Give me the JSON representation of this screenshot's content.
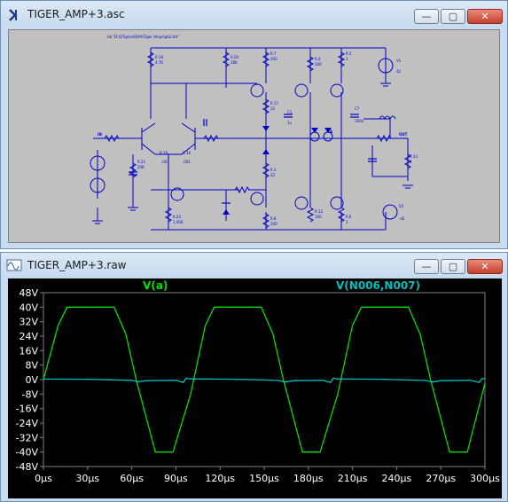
{
  "schematic_window": {
    "title": "TIGER_AMP+3.asc",
    "buttons": {
      "minimize": "—",
      "maximize": "▢",
      "close": "✕"
    },
    "directive": ".lib \"D:\\LTSpice\\DIYA\\Tiger Amps\\pb2.txt\"",
    "components": [
      {
        "ref": "R.18",
        "value": "4.7K"
      },
      {
        "ref": "R.20",
        "value": "18K"
      },
      {
        "ref": "R.7",
        "value": "200"
      },
      {
        "ref": "R.4",
        "value": "100"
      },
      {
        "ref": "R.5",
        "value": "1"
      },
      {
        "ref": "V1",
        "value": "42"
      },
      {
        "ref": "R.17",
        "value": "22"
      },
      {
        "ref": "C1",
        "value": "1u"
      },
      {
        "ref": "C7",
        "value": "100n"
      },
      {
        "ref": "R.19",
        "value": ".001"
      },
      {
        "ref": "R.16",
        "value": ".001"
      },
      {
        "ref": "R.21",
        "value": "20K"
      },
      {
        "ref": "R.3",
        "value": "22"
      },
      {
        "ref": "R.14",
        "value": "4"
      },
      {
        "ref": "R.22",
        "value": "1.95K"
      },
      {
        "ref": "R.12",
        "value": "100"
      },
      {
        "ref": "R.6",
        "value": "1"
      },
      {
        "ref": "R.8",
        "value": "200"
      },
      {
        "ref": "V2",
        "value": "-42"
      }
    ],
    "nets": {
      "input": "IN",
      "output": "OUT",
      "a": "A"
    }
  },
  "waveform_window": {
    "title": "TIGER_AMP+3.raw",
    "buttons": {
      "minimize": "—",
      "maximize": "▢",
      "close": "✕"
    }
  },
  "chart_data": {
    "type": "line",
    "xlabel": "",
    "ylabel": "",
    "xlim": [
      0,
      300
    ],
    "ylim": [
      -48,
      48
    ],
    "x_ticks": [
      "0µs",
      "30µs",
      "60µs",
      "90µs",
      "120µs",
      "150µs",
      "180µs",
      "210µs",
      "240µs",
      "270µs",
      "300µs"
    ],
    "y_ticks": [
      "48V",
      "40V",
      "32V",
      "24V",
      "16V",
      "8V",
      "0V",
      "-8V",
      "-16V",
      "-24V",
      "-32V",
      "-40V",
      "-48V"
    ],
    "grid": false,
    "series": [
      {
        "name": "V(a)",
        "color": "#00e000",
        "x": [
          0,
          10,
          16,
          28,
          48,
          56,
          63,
          76,
          84,
          88,
          100,
          110,
          116,
          128,
          148,
          156,
          163,
          176,
          184,
          188,
          200,
          210,
          216,
          228,
          248,
          256,
          263,
          276,
          284,
          288,
          300
        ],
        "y": [
          0,
          30,
          40,
          40,
          40,
          25,
          0,
          -40,
          -40,
          -40,
          -8,
          30,
          40,
          40,
          40,
          25,
          0,
          -40,
          -40,
          -40,
          -8,
          30,
          40,
          40,
          40,
          25,
          0,
          -40,
          -40,
          -40,
          -2
        ]
      },
      {
        "name": "V(N006,N007)",
        "color": "#00bfbf",
        "x": [
          0,
          30,
          60,
          64,
          70,
          90,
          95,
          97,
          99,
          130,
          150,
          160,
          164,
          170,
          190,
          195,
          197,
          199,
          230,
          260,
          264,
          270,
          290,
          296,
          298,
          300
        ],
        "y": [
          0.3,
          0.2,
          -0.4,
          -1.2,
          -0.6,
          -0.4,
          -1.6,
          0.8,
          0.4,
          0.2,
          -0.2,
          -0.5,
          -1.3,
          -0.6,
          -0.4,
          -1.6,
          0.8,
          0.4,
          0.2,
          -0.5,
          -1.3,
          -0.6,
          -0.4,
          -1.5,
          0.6,
          0.4
        ]
      }
    ]
  }
}
